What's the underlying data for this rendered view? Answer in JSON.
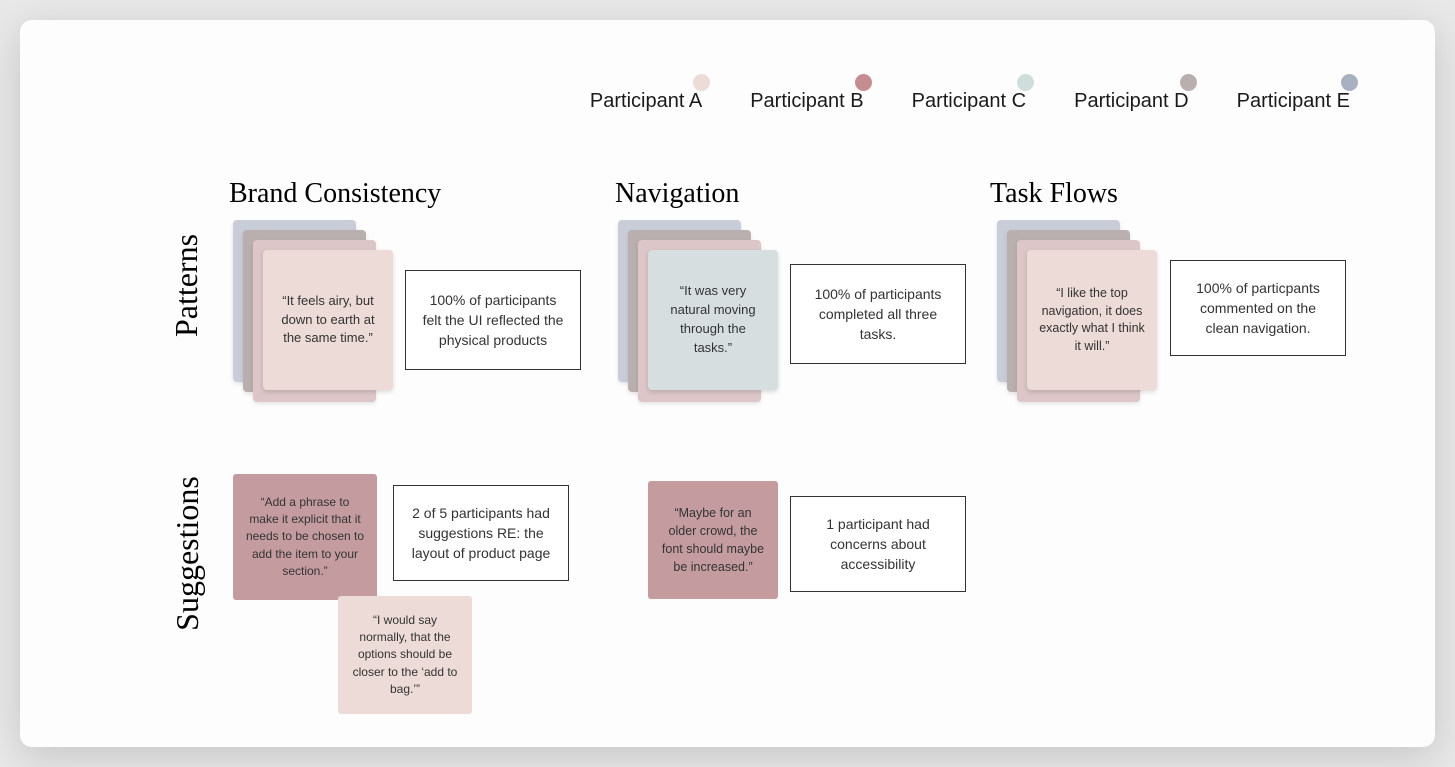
{
  "legend": {
    "items": [
      {
        "label": "Participant A",
        "color": "#ecdbd6"
      },
      {
        "label": "Participant B",
        "color": "#c48e91"
      },
      {
        "label": "Participant C",
        "color": "#cfdedb"
      },
      {
        "label": "Participant D",
        "color": "#b9afaf"
      },
      {
        "label": "Participant E",
        "color": "#a9b1c0"
      }
    ]
  },
  "rowLabels": {
    "patterns": "Patterns",
    "suggestions": "Suggestions"
  },
  "columns": {
    "brand": "Brand Consistency",
    "navigation": "Navigation",
    "taskFlows": "Task Flows"
  },
  "patterns": {
    "brand": {
      "quote": "“It feels airy, but down to earth at the same time.”",
      "summary": "100% of participants felt the UI  reflected the  physical products"
    },
    "navigation": {
      "quote": "“It was very natural moving through the tasks.”",
      "summary": "100% of participants completed all three tasks."
    },
    "taskFlows": {
      "quote": "“I like the top navigation, it does exactly what I think it will.”",
      "summary": "100% of particpants commented on the clean navigation."
    }
  },
  "suggestions": {
    "brand": {
      "quote1": "“Add a phrase to make it explicit that it needs to be chosen to add the item to your section.”",
      "quote2": "“I would say normally, that the options should be closer to the ‘add to bag.’”",
      "summary": "2 of 5 participants had suggestions RE: the layout of product page"
    },
    "navigation": {
      "quote": "“Maybe for an older crowd, the font should maybe be increased.”",
      "summary": "1 participant had concerns about accessibility"
    }
  },
  "stackColors": {
    "back": "#c8cdd8",
    "mid1": "#b9afaf",
    "mid2": "#dcc6c7",
    "frontPinkLight": "#ecdbd6",
    "frontGreyBlue": "#d6dee0",
    "cardRose": "#c49ca0"
  }
}
